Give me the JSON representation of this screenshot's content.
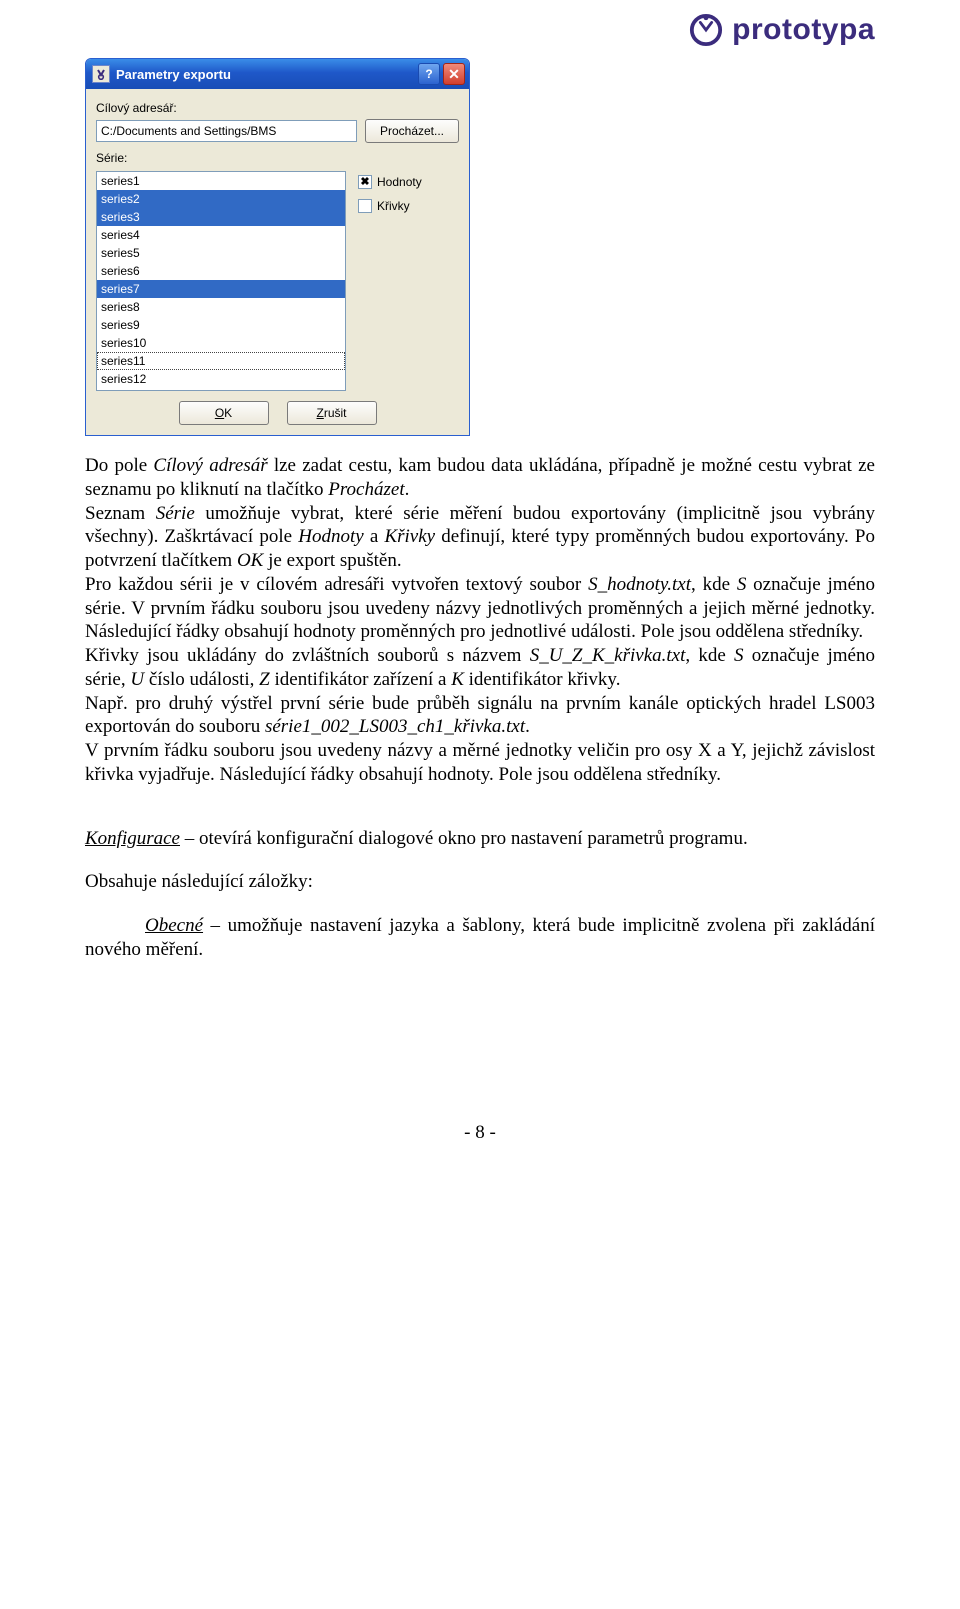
{
  "logo": {
    "text": "prototypa"
  },
  "dialog": {
    "title": "Parametry exportu",
    "target_label": "Cílový adresář:",
    "path_value": "C:/Documents and Settings/BMS",
    "browse_label": "Procházet...",
    "series_label": "Série:",
    "items": [
      "series1",
      "series2",
      "series3",
      "series4",
      "series5",
      "series6",
      "series7",
      "series8",
      "series9",
      "series10",
      "series11",
      "series12"
    ],
    "selected_idx": [
      1,
      2,
      6
    ],
    "focus_idx": 10,
    "check_hodnoty_label": "Hodnoty",
    "check_hodnoty_checked": true,
    "check_krivky_label": "Křivky",
    "check_krivky_checked": false,
    "ok_label": "OK",
    "cancel_label": "Zrušit"
  },
  "body": {
    "p1a": "Do pole ",
    "p1b": "Cílový adresář",
    "p1c": " lze zadat cestu, kam budou data ukládána, případně je možné cestu vybrat ze seznamu po kliknutí na tlačítko ",
    "p1d": "Procházet",
    "p1e": ".",
    "p2a": "Seznam ",
    "p2b": "Série",
    "p2c": " umožňuje vybrat, které série měření budou exportovány (implicitně jsou vybrány všechny). Zaškrtávací pole ",
    "p2d": "Hodnoty",
    "p2e": " a ",
    "p2f": "Křivky",
    "p2g": " definují, které typy proměnných budou exportovány. Po potvrzení tlačítkem ",
    "p2h": "OK",
    "p2i": " je export spuštěn.",
    "p3a": "Pro každou sérii je v cílovém adresáři vytvořen textový soubor ",
    "p3b": "S_hodnoty.txt",
    "p3c": ", kde ",
    "p3d": "S",
    "p3e": " označuje jméno série. V prvním řádku souboru jsou uvedeny názvy jednotlivých proměnných a jejich měrné jednotky. Následující řádky obsahují hodnoty proměnných  pro jednotlivé události. Pole jsou oddělena středníky.",
    "p4a": "Křivky jsou ukládány do zvláštních souborů s názvem ",
    "p4b": "S_U_Z_K_křivka.txt",
    "p4c": ", kde ",
    "p4d": "S",
    "p4e": " označuje jméno série, ",
    "p4f": "U",
    "p4g": " číslo události, ",
    "p4h": "Z",
    "p4i": " identifikátor zařízení a ",
    "p4j": "K",
    "p4k": " identifikátor křivky.",
    "p5a": "Např. pro druhý výstřel první série bude průběh signálu na prvním kanále optických hradel LS003 exportován do souboru ",
    "p5b": "série1_002_LS003_ch1_křivka.txt",
    "p5c": ".",
    "p6": "V prvním řádku souboru jsou uvedeny názvy a měrné jednotky veličin pro osy X a Y, jejichž závislost křivka vyjadřuje. Následující řádky obsahují hodnoty. Pole jsou oddělena středníky.",
    "cfg_a": "Konfigurace",
    "cfg_b": " – otevírá konfigurační dialogové okno pro nastavení parametrů programu.",
    "contains": "Obsahuje následující záložky:",
    "obec_a": "Obecné",
    "obec_b": " – umožňuje nastavení jazyka a šablony, která bude implicitně zvolena při zakládání nového měření."
  },
  "footer": "- 8 -"
}
